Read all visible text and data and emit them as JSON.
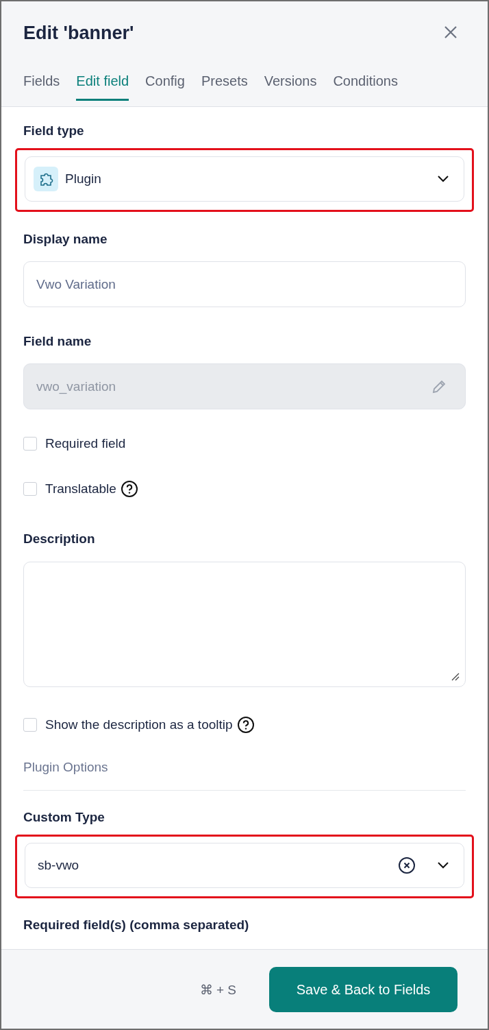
{
  "header": {
    "title": "Edit 'banner'"
  },
  "tabs": [
    {
      "label": "Fields",
      "selected": false
    },
    {
      "label": "Edit field",
      "selected": true
    },
    {
      "label": "Config",
      "selected": false
    },
    {
      "label": "Presets",
      "selected": false
    },
    {
      "label": "Versions",
      "selected": false
    },
    {
      "label": "Conditions",
      "selected": false
    }
  ],
  "field_type": {
    "label": "Field type",
    "value": "Plugin",
    "highlighted": true
  },
  "display_name": {
    "label": "Display name",
    "placeholder": "Vwo Variation"
  },
  "field_name": {
    "label": "Field name",
    "value": "vwo_variation",
    "disabled": true
  },
  "options": [
    {
      "label": "Required field",
      "checked": false,
      "help": false
    },
    {
      "label": "Translatable",
      "checked": false,
      "help": true
    }
  ],
  "description": {
    "label": "Description"
  },
  "tooltip_option": {
    "label": "Show the description as a tooltip",
    "checked": false,
    "help": true
  },
  "section_title": "Plugin Options",
  "custom_type": {
    "label": "Custom Type",
    "value": "sb-vwo",
    "highlighted": true
  },
  "required_fields": {
    "label": "Required field(s) (comma separated)"
  },
  "footer": {
    "shortcut": "⌘ + S",
    "button": "Save & Back to Fields"
  }
}
